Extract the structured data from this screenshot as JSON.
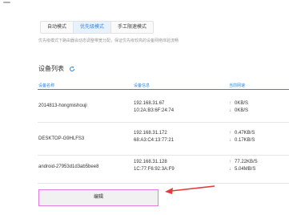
{
  "top_icon": "minus-icon",
  "modes": {
    "tabs": [
      {
        "label": "自动模式"
      },
      {
        "label": "优先级模式",
        "active": true
      },
      {
        "label": "手工限速模式"
      }
    ],
    "description": "优先级模式下路由器会动态调整带宽分配，保证优先级较高的设备网络体验流畅"
  },
  "device_list": {
    "title": "设备列表",
    "refresh_icon": "refresh-icon",
    "columns": {
      "name": "设备名称",
      "info": "设备信息",
      "speed": "当前网速"
    },
    "rows": [
      {
        "name": "2014813-hongmishouji",
        "ip": "192.168.31.67",
        "mac": "10:2A:B3:6F:24:74",
        "up": "0KB/S",
        "down": "0KB/S"
      },
      {
        "name": "DESKTOP-G9HLFS3",
        "ip": "192.168.31.172",
        "mac": "68:A3:C4:13:77:21",
        "up": "0.47KB/S",
        "down": "0.17KB/S"
      },
      {
        "name": "android-27953d1d3ab5bee8",
        "ip": "192.168.31.128",
        "mac": "1C:77:F6:92:3A:F9",
        "up": "77.22KB/S",
        "down": "5.04MB/S"
      }
    ]
  },
  "edit_button": {
    "label": "编辑"
  },
  "colors": {
    "accent": "#2f86e6",
    "upload": "#4caf50",
    "annotation_arrow": "#e03c3c",
    "annotation_box": "#e07de0"
  }
}
